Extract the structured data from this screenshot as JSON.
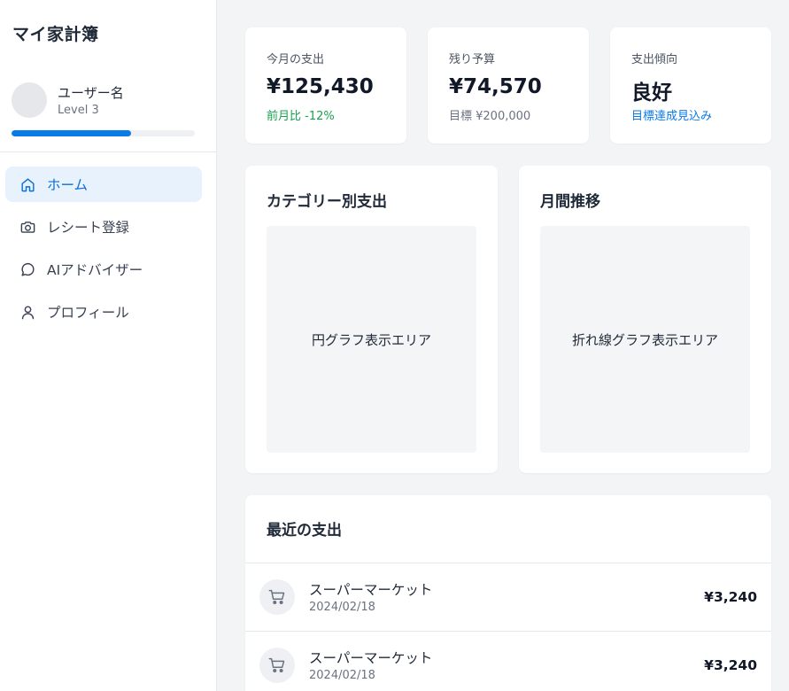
{
  "app": {
    "title": "マイ家計簿"
  },
  "user": {
    "name": "ユーザー名",
    "level": "Level 3",
    "progress": 0.65
  },
  "nav": {
    "items": [
      {
        "label": "ホーム",
        "icon": "home-icon",
        "active": true
      },
      {
        "label": "レシート登録",
        "icon": "camera-icon",
        "active": false
      },
      {
        "label": "AIアドバイザー",
        "icon": "chat-bubble-icon",
        "active": false
      },
      {
        "label": "プロフィール",
        "icon": "user-icon",
        "active": false
      }
    ]
  },
  "stats": [
    {
      "label": "今月の支出",
      "value": "¥125,430",
      "sub": "前月比 -12%",
      "sub_color": "#16a34a"
    },
    {
      "label": "残り予算",
      "value": "¥74,570",
      "sub": "目標 ¥200,000",
      "sub_color": "#6b7280"
    },
    {
      "label": "支出傾向",
      "value": "良好",
      "sub": "目標達成見込み",
      "sub_color": "#0a7ae6"
    }
  ],
  "charts": {
    "category": {
      "title": "カテゴリー別支出",
      "placeholder": "円グラフ表示エリア"
    },
    "monthly": {
      "title": "月間推移",
      "placeholder": "折れ線グラフ表示エリア"
    }
  },
  "recent": {
    "title": "最近の支出",
    "items": [
      {
        "name": "スーパーマーケット",
        "date": "2024/02/18",
        "amount": "¥3,240",
        "icon": "shopping-cart-icon"
      },
      {
        "name": "スーパーマーケット",
        "date": "2024/02/18",
        "amount": "¥3,240",
        "icon": "shopping-cart-icon"
      }
    ]
  },
  "colors": {
    "accent": "#0a7ae6",
    "active_bg": "#e8f2fd",
    "positive": "#16a34a"
  }
}
